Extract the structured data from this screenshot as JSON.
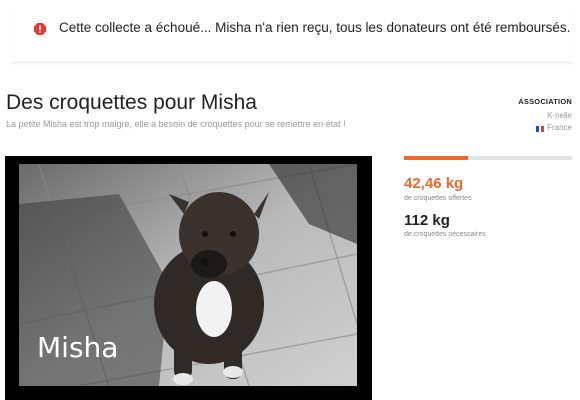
{
  "alert": {
    "icon": "error-icon",
    "message": "Cette collecte a échoué... Misha n'a rien reçu, tous les donateurs ont été remboursés.",
    "color": "#e53935"
  },
  "campaign": {
    "title": "Des croquettes pour Misha",
    "subtitle": "La petite Misha est trop maigre, elle a besoin de croquettes pour se remettre en état !"
  },
  "association": {
    "heading": "ASSOCIATION",
    "name": "K-nelle",
    "country": "France",
    "flag_icon": "france-flag-icon"
  },
  "photo": {
    "caption": "Misha"
  },
  "progress": {
    "fraction": 0.38,
    "color": "#f0662b"
  },
  "stats": {
    "offered_value": "42,46 kg",
    "offered_label": "de croquettes offertes",
    "needed_value": "112 kg",
    "needed_label": "de croquettes nécessaires",
    "accent_color": "#f0662b"
  }
}
